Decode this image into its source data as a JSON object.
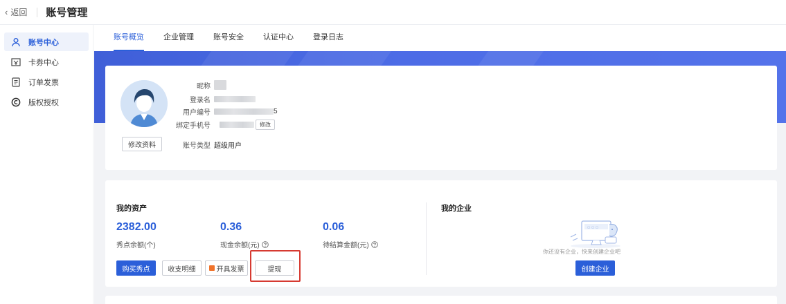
{
  "header": {
    "back_label": "返回",
    "title": "账号管理"
  },
  "sidebar": {
    "items": [
      {
        "label": "账号中心",
        "icon": "user-icon",
        "active": true
      },
      {
        "label": "卡券中心",
        "icon": "coupon-icon",
        "active": false
      },
      {
        "label": "订单发票",
        "icon": "invoice-list-icon",
        "active": false
      },
      {
        "label": "版权授权",
        "icon": "copyright-icon",
        "active": false
      }
    ]
  },
  "tabs": [
    {
      "label": "账号概览",
      "active": true
    },
    {
      "label": "企业管理",
      "active": false
    },
    {
      "label": "账号安全",
      "active": false
    },
    {
      "label": "认证中心",
      "active": false
    },
    {
      "label": "登录日志",
      "active": false
    }
  ],
  "profile": {
    "edit_button": "修改资料",
    "nickname_label": "昵称",
    "login_label": "登录名",
    "user_id_label": "用户编号",
    "user_id_suffix": "5",
    "phone_label": "绑定手机号",
    "phone_modify_button": "修改",
    "account_type_label": "账号类型",
    "account_type_value": "超级用户"
  },
  "assets": {
    "title": "我的资产",
    "items": [
      {
        "amount": "2382.00",
        "label": "秀点余额(个)"
      },
      {
        "amount": "0.36",
        "label": "现金余额(元)"
      },
      {
        "amount": "0.06",
        "label": "待结算金额(元)"
      }
    ],
    "buttons": {
      "buy": "购买秀点",
      "details": "收支明细",
      "invoice": "开具发票",
      "withdraw": "提现"
    }
  },
  "enterprise": {
    "title": "我的企业",
    "empty_text": "你还没有企业，快来创建企业吧",
    "create_button": "创建企业"
  },
  "colors": {
    "primary": "#2b5fd9",
    "banner": "#4d6ce6",
    "highlight": "#d63a31",
    "invoice_icon": "#f0732b"
  }
}
